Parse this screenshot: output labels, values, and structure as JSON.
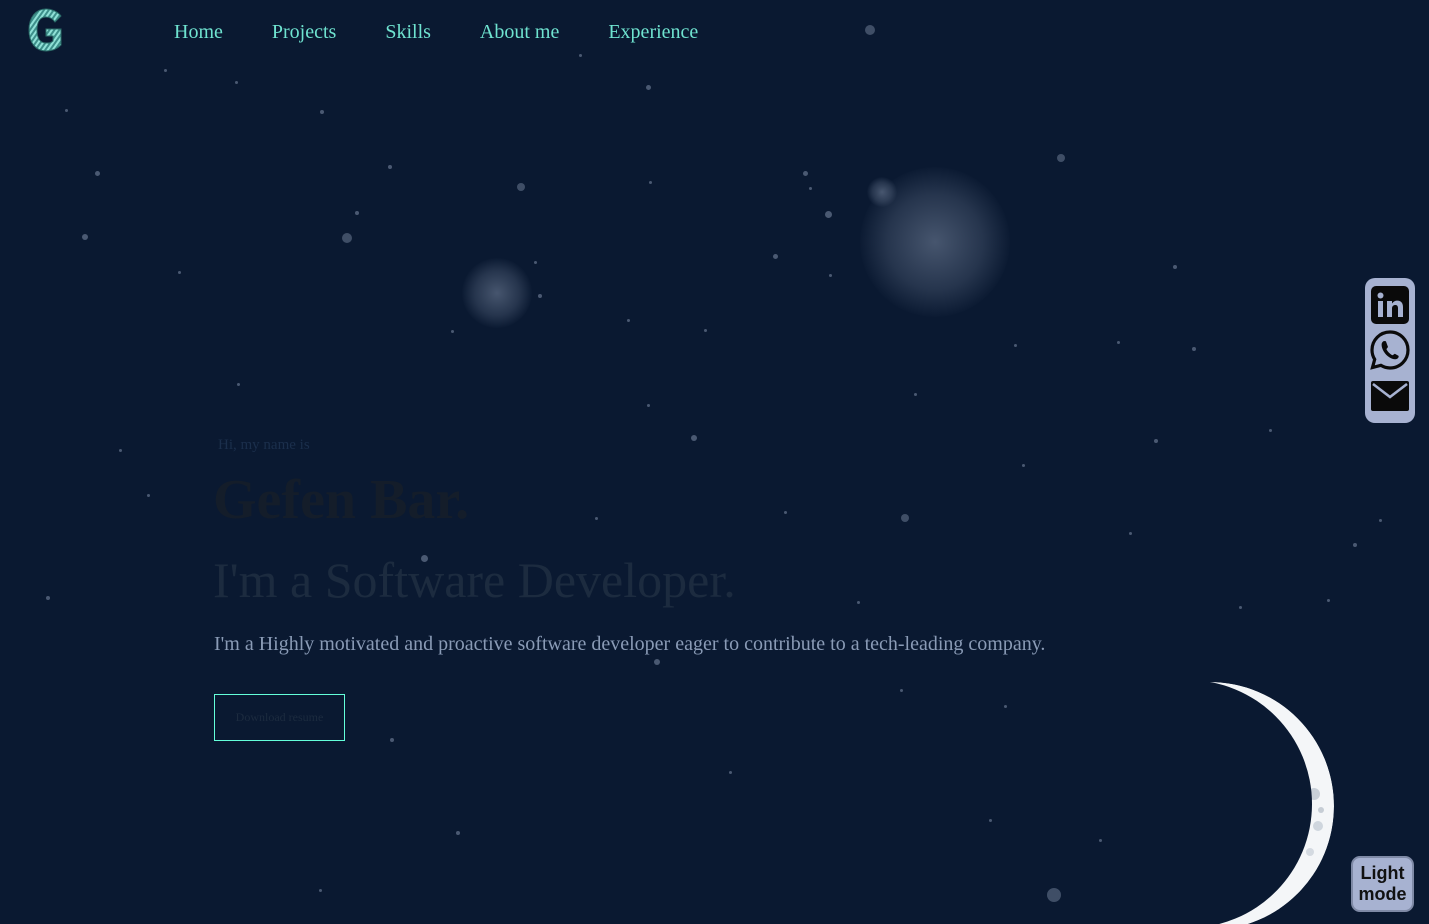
{
  "nav": {
    "items": [
      {
        "label": "Home"
      },
      {
        "label": "Projects"
      },
      {
        "label": "Skills"
      },
      {
        "label": "About me"
      },
      {
        "label": "Experience"
      }
    ]
  },
  "hero": {
    "greeting": "Hi, my name is",
    "name": "Gefen Bar.",
    "role": "I'm a Software Developer.",
    "description": "I'm a Highly motivated and proactive software developer eager to contribute to a tech-leading company.",
    "resume_button": "Download resume"
  },
  "social": {
    "icons": [
      "linkedin-icon",
      "whatsapp-icon",
      "email-icon"
    ]
  },
  "theme_toggle": {
    "line1": "Light",
    "line2": "mode"
  },
  "colors": {
    "background": "#0a1931",
    "accent": "#64ffda",
    "panel": "#a7b2d1"
  }
}
